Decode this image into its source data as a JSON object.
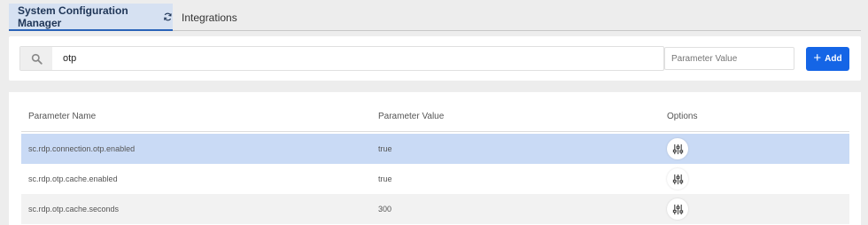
{
  "tabs": [
    {
      "label": "System Configuration Manager",
      "active": true
    },
    {
      "label": "Integrations",
      "active": false
    }
  ],
  "search": {
    "value": "otp",
    "param_value_placeholder": "Parameter Value",
    "add_label": "Add"
  },
  "table": {
    "headers": [
      "Parameter Name",
      "Parameter Value",
      "Options"
    ],
    "rows": [
      {
        "name": "sc.rdp.connection.otp.enabled",
        "value": "true",
        "selected": true
      },
      {
        "name": "sc.rdp.otp.cache.enabled",
        "value": "true",
        "selected": false
      },
      {
        "name": "sc.rdp.otp.cache.seconds",
        "value": "300",
        "selected": false
      }
    ]
  },
  "colors": {
    "accent": "#1565e6",
    "active_tab_bg": "#d6e1f2",
    "selected_row_bg": "#c9daf5",
    "page_bg": "#ededed"
  },
  "icons": {
    "refresh": "refresh-icon",
    "search": "search-icon",
    "add": "plus-icon",
    "options": "sliders-icon"
  }
}
